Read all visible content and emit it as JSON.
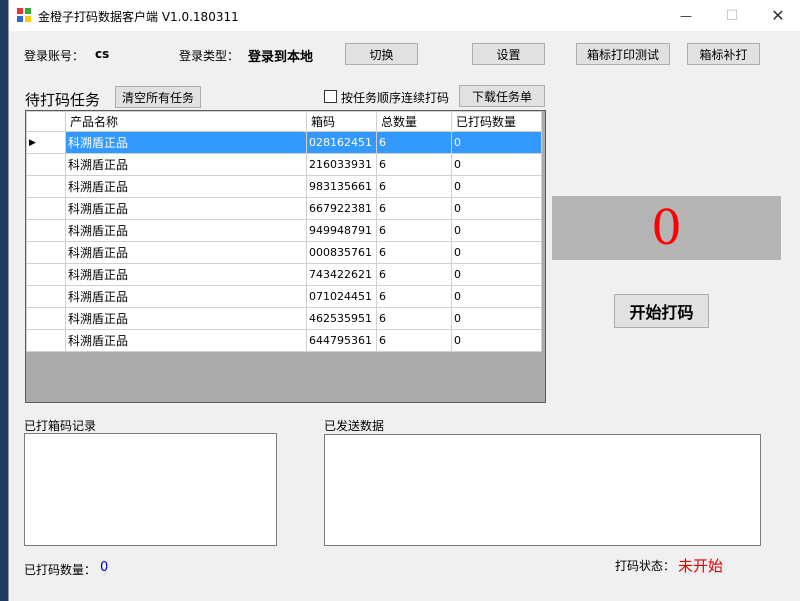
{
  "window": {
    "title": "金橙子打码数据客户端 V1.0.180311",
    "minimize_glyph": "—",
    "maximize_glyph": "☐",
    "close_glyph": "✕"
  },
  "header": {
    "account_label": "登录账号：",
    "account_value": "cs",
    "login_type_label": "登录类型：",
    "login_type_value": "登录到本地",
    "switch_button": "切换",
    "settings_button": "设置",
    "test_print_button": "箱标打印测试",
    "reprint_button": "箱标补打"
  },
  "tasks": {
    "title": "待打码任务",
    "clear_button": "清空所有任务",
    "sequential_checkbox_label": "按任务顺序连续打码",
    "sequential_checked": false,
    "download_button": "下载任务单",
    "columns": [
      "产品名称",
      "箱码",
      "总数量",
      "已打码数量"
    ],
    "rows": [
      {
        "name": "科溯盾正品",
        "code": "028162451",
        "total": "6",
        "printed": "0"
      },
      {
        "name": "科溯盾正品",
        "code": "216033931",
        "total": "6",
        "printed": "0"
      },
      {
        "name": "科溯盾正品",
        "code": "983135661",
        "total": "6",
        "printed": "0"
      },
      {
        "name": "科溯盾正品",
        "code": "667922381",
        "total": "6",
        "printed": "0"
      },
      {
        "name": "科溯盾正品",
        "code": "949948791",
        "total": "6",
        "printed": "0"
      },
      {
        "name": "科溯盾正品",
        "code": "000835761",
        "total": "6",
        "printed": "0"
      },
      {
        "name": "科溯盾正品",
        "code": "743422621",
        "total": "6",
        "printed": "0"
      },
      {
        "name": "科溯盾正品",
        "code": "071024451",
        "total": "6",
        "printed": "0"
      },
      {
        "name": "科溯盾正品",
        "code": "462535951",
        "total": "6",
        "printed": "0"
      },
      {
        "name": "科溯盾正品",
        "code": "644795361",
        "total": "6",
        "printed": "0"
      }
    ],
    "selected_row_marker": "▶"
  },
  "counter": {
    "value": "0"
  },
  "start_button": "开始打码",
  "records": {
    "printed_box_label": "已打箱码记录",
    "sent_data_label": "已发送数据",
    "printed_count_label": "已打码数量：",
    "printed_count_value": "0",
    "status_label": "打码状态：",
    "status_value": "未开始"
  },
  "colors": {
    "selection": "#3399ff",
    "counter_text": "#ff0000",
    "status_text": "#e00000",
    "count_value": "#0000cc"
  }
}
